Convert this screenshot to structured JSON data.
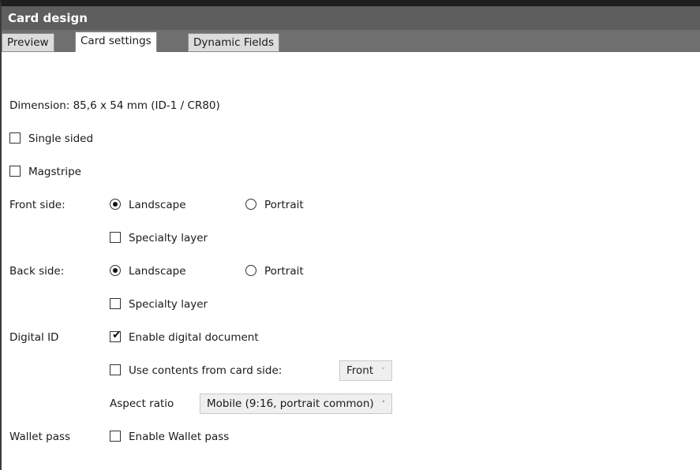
{
  "window": {
    "title": "Card design"
  },
  "tabs": [
    {
      "label": "Preview",
      "active": false
    },
    {
      "label": "Card settings",
      "active": true
    },
    {
      "label": "Dynamic Fields",
      "active": false
    }
  ],
  "settings": {
    "dimension_text": "Dimension: 85,6 x 54 mm (ID-1 / CR80)",
    "single_sided": {
      "label": "Single sided",
      "checked": false
    },
    "magstripe": {
      "label": "Magstripe",
      "checked": false
    },
    "front_side": {
      "label": "Front side:",
      "landscape": {
        "label": "Landscape",
        "selected": true
      },
      "portrait": {
        "label": "Portrait",
        "selected": false
      },
      "specialty_layer": {
        "label": "Specialty layer",
        "checked": false
      }
    },
    "back_side": {
      "label": "Back side:",
      "landscape": {
        "label": "Landscape",
        "selected": true
      },
      "portrait": {
        "label": "Portrait",
        "selected": false
      },
      "specialty_layer": {
        "label": "Specialty layer",
        "checked": false
      }
    },
    "digital_id": {
      "label": "Digital ID",
      "enable_digital_document": {
        "label": "Enable digital document",
        "checked": true
      },
      "use_contents": {
        "label": "Use contents from card side:",
        "checked": false
      },
      "card_side_select": {
        "value": "Front"
      },
      "aspect_ratio_label": "Aspect ratio",
      "aspect_ratio_select": {
        "value": "Mobile (9:16, portrait common)"
      }
    },
    "wallet_pass": {
      "label": "Wallet pass",
      "enable_wallet_pass": {
        "label": "Enable Wallet pass",
        "checked": false
      }
    }
  },
  "icons": {
    "checkmark": "✔",
    "dropdown_arrow": "˅"
  }
}
